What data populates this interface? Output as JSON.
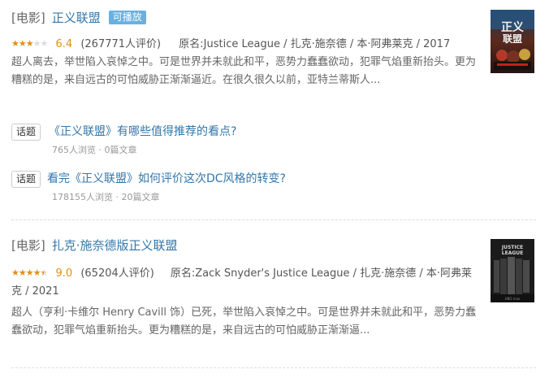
{
  "results": [
    {
      "category": "[电影]",
      "title": "正义联盟",
      "badge": "可播放",
      "stars": [
        1,
        1,
        1,
        0,
        0
      ],
      "score": "6.4",
      "votes": "(267771人评价)",
      "meta": "原名:Justice League / 扎克·施奈德 / 本·阿弗莱克 / 2017",
      "abstract": "超人离去，举世陷入哀悼之中。可是世界并未就此和平，恶势力蠢蠢欲动，犯罪气焰重新抬头。更为糟糕的是，来自远古的可怕威胁正渐渐逼近。在很久很久以前，亚特兰蒂斯人...",
      "topics": [
        {
          "tag": "话题",
          "title": "《正义联盟》有哪些值得推荐的看点?",
          "meta": "765人浏览 · 0篇文章"
        },
        {
          "tag": "话题",
          "title": "看完《正义联盟》如何评价这次DC风格的转变?",
          "meta": "178155人浏览 · 20篇文章"
        }
      ]
    },
    {
      "category": "[电影]",
      "title": "扎克·施奈德版正义联盟",
      "stars": [
        1,
        1,
        1,
        1,
        0.5
      ],
      "score": "9.0",
      "votes": "(65204人评价)",
      "meta": "原名:Zack Snyder's Justice League / 扎克·施奈德 / 本·阿弗莱克 / 2021",
      "abstract": "超人（亨利·卡维尔 Henry Cavill 饰）已死，举世陷入哀悼之中。可是世界并未就此和平，恶势力蠢蠢欲动，犯罪气焰重新抬头。更为糟糕的是，来自远古的可怕威胁正渐渐逼..."
    }
  ],
  "colors": {
    "link": "#3377aa",
    "star": "#e09015",
    "badge": "#6ab0e0"
  }
}
